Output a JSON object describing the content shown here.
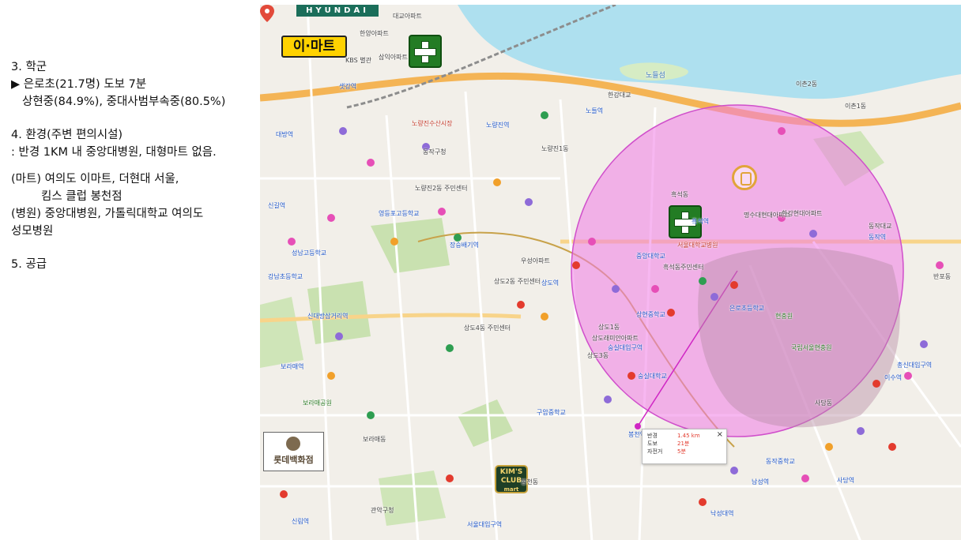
{
  "sidebar": {
    "school_title": "3. 학군",
    "school_line1": "▶ 은로초(21.7명) 도보 7분",
    "school_line2": "상현중(84.9%), 중대사범부속중(80.5%)",
    "env_title": "4. 환경(주변 편의시설)",
    "env_line1": ": 반경 1KM 내 중앙대병원, 대형마트 없음.",
    "mart_line1": "(마트) 여의도 이마트, 더현대 서울,",
    "mart_line2": "킴스 클럽 봉천점",
    "hosp_line1": "(병원) 중앙대병원, 가톨릭대학교 여의도",
    "hosp_line2": "성모병원",
    "supply_title": "5. 공급"
  },
  "map": {
    "brand_hyundai": "HYUNDAI",
    "brand_emart": "이·마트",
    "brand_lotte": "롯데백화점",
    "brand_kims_1": "KIM'S",
    "brand_kims_2": "CLUB",
    "brand_kims_3": "mart",
    "labels": [
      "대교아파트",
      "한양아파트",
      "삼익아파트",
      "KBS 별관",
      "샛강역",
      "노량진수산시장",
      "노량진역",
      "동작구청",
      "노량진1동",
      "노량진2동 주민센터",
      "장승배기역",
      "상도역",
      "숭실대입구역",
      "상도1동",
      "상도2동 주민센터",
      "상도3동",
      "상도4동 주민센터",
      "신대방삼거리역",
      "보라매역",
      "보라매공원",
      "보라매동",
      "숭실대학교",
      "중앙대학교",
      "흑석역",
      "흑석동",
      "흑석동주민센터",
      "명수대현대아파트",
      "동작역",
      "현충원",
      "국립서울현충원",
      "사당동",
      "사당역",
      "남성역",
      "이수역",
      "총신대입구역",
      "봉천역",
      "서울대입구역",
      "낙성대역",
      "신림역",
      "관악구청",
      "봉천동",
      "이촌2동",
      "이촌1동",
      "반포동",
      "노들섬",
      "노들역",
      "한강대교",
      "동작대교",
      "대방역",
      "신길역",
      "우성아파트",
      "상도래미안아파트",
      "강남초등학교",
      "영등포고등학교",
      "상현중학교",
      "은로초등학교",
      "서울대학교병원",
      "한강현대아파트",
      "성남고등학교",
      "동작중학교",
      "구암중학교"
    ],
    "popup": {
      "radius_label": "반경",
      "radius_value": "1.45 km",
      "walk_label": "도보",
      "walk_value": "21분",
      "bike_label": "자전거",
      "bike_value": "5분",
      "close": "×"
    }
  },
  "colors": {
    "radius_fill": "#f07be6",
    "water": "#aee0ef",
    "highway": "#f4b455",
    "hospital": "#237c24",
    "park": "#c9e1b0",
    "popup_value": "#e33b2e"
  }
}
